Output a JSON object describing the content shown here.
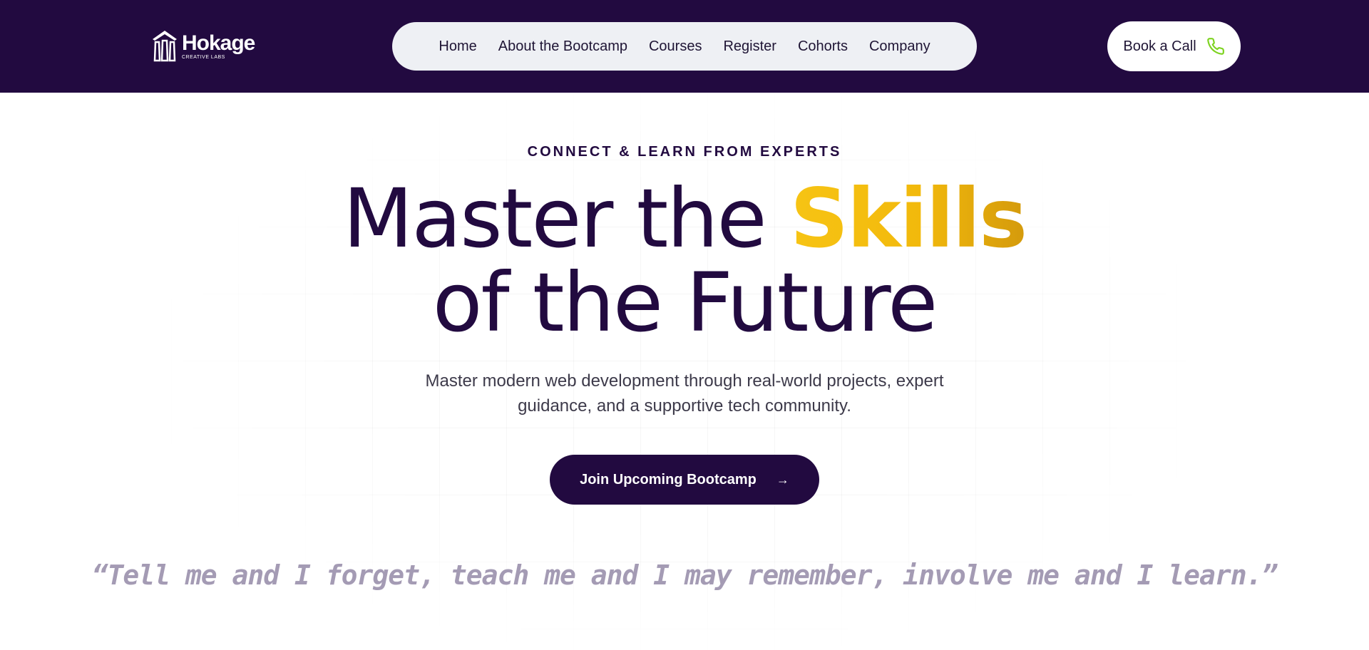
{
  "header": {
    "logo": {
      "name": "Hokage",
      "subtitle": "CREATIVE LABS"
    },
    "nav": [
      {
        "label": "Home"
      },
      {
        "label": "About the Bootcamp"
      },
      {
        "label": "Courses"
      },
      {
        "label": "Register"
      },
      {
        "label": "Cohorts"
      },
      {
        "label": "Company"
      }
    ],
    "book_call": {
      "label": "Book a Call",
      "icon": "phone-icon"
    }
  },
  "hero": {
    "eyebrow": "CONNECT & LEARN FROM EXPERTS",
    "headline_part1": "Master the ",
    "headline_highlight": "Skills",
    "headline_line2": "of the Future",
    "subtitle": "Master modern web development through real-world projects, expert guidance, and a supportive tech community.",
    "cta": {
      "label": "Join Upcoming Bootcamp",
      "icon": "arrow-right-icon"
    },
    "quote": "“Tell me and I forget, teach me and I may remember, involve me and I learn.”"
  },
  "colors": {
    "header_bg": "#220a40",
    "primary": "#220a40",
    "highlight_gold": "#f2b90c",
    "nav_pill_bg": "#eef0f4",
    "phone_icon_green": "#7ed321",
    "quote_text": "#a49bb4"
  }
}
